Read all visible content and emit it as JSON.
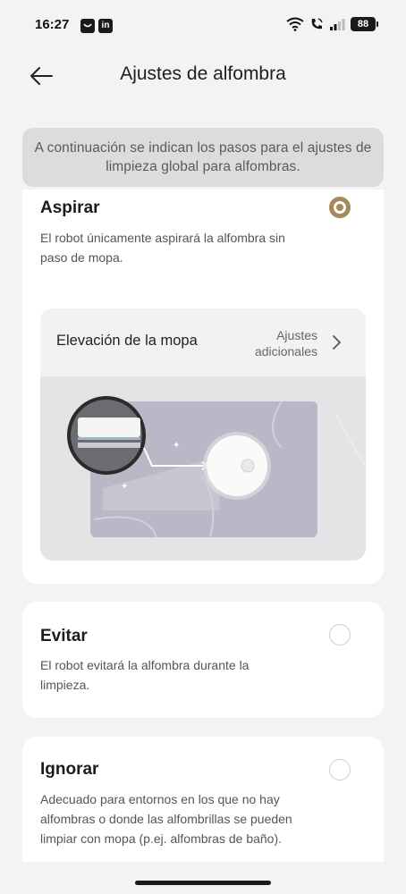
{
  "status_bar": {
    "time": "16:27",
    "app_icons": [
      "message-icon",
      "linkedin-icon"
    ],
    "linkedin_glyph": "in",
    "battery": "88"
  },
  "header": {
    "title": "Ajustes de alfombra",
    "back_icon": "back-arrow-icon"
  },
  "banner": {
    "text": "A continuación se indican los pasos para el ajustes de limpieza global para alfombras."
  },
  "options": [
    {
      "title": "Aspirar",
      "description": "El robot únicamente aspirará la alfombra sin paso de mopa.",
      "selected": true
    },
    {
      "title": "Evitar",
      "description": "El robot evitará la alfombra durante la limpieza.",
      "selected": false
    },
    {
      "title": "Ignorar",
      "description": "Adecuado para entornos en los que no hay alfombras o donde las alfombrillas se pueden limpiar con mopa (p.ej. alfombras de baño).",
      "selected": false
    }
  ],
  "mop_lift": {
    "label": "Elevación de la mopa",
    "extra_line1": "Ajustes",
    "extra_line2": "adicionales"
  },
  "colors": {
    "accent": "#a78a5c",
    "background": "#f3f3f3",
    "card": "#ffffff"
  }
}
